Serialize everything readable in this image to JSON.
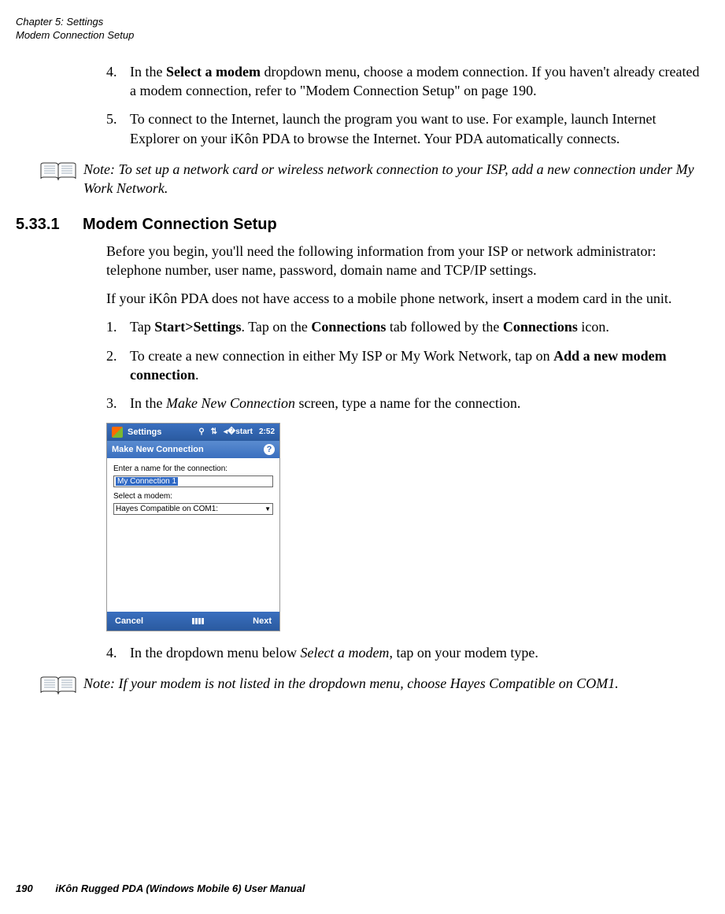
{
  "header": {
    "chapter": "Chapter 5:  Settings",
    "section": "Modem Connection Setup"
  },
  "step4": {
    "num": "4.",
    "pre": "In the ",
    "bold1": "Select a modem",
    "post": " dropdown menu, choose a modem connection. If you haven't already created a modem connection, refer to \"Modem Connection Setup\" on page 190."
  },
  "step5": {
    "num": "5.",
    "text": "To connect to the Internet, launch the program you want to use. For example, launch Internet Explorer on your iKôn PDA to browse the Internet. Your PDA automatically connects."
  },
  "note1": {
    "label": "Note:",
    "text": " To set up a network card or wireless network connection to your ISP, add a new connection under My Work Network."
  },
  "heading": {
    "num": "5.33.1",
    "title": "Modem Connection Setup"
  },
  "para1": "Before you begin, you'll need the following information from your ISP or network administrator: telephone number, user name, password, domain name and TCP/IP settings.",
  "para2": "If your iKôn PDA does not have access to a mobile phone network, insert a modem card in the unit.",
  "substeps": {
    "s1": {
      "num": "1.",
      "pre": "Tap ",
      "b1": "Start>Settings",
      "mid1": ". Tap on the ",
      "b2": "Connections",
      "mid2": " tab followed by the ",
      "b3": "Connections",
      "post": " icon."
    },
    "s2": {
      "num": "2.",
      "pre": "To create a new connection in either My ISP or My Work Network, tap on ",
      "b1": "Add a new modem connection",
      "post": "."
    },
    "s3": {
      "num": "3.",
      "pre": "In the ",
      "i1": "Make New Connection",
      "post": " screen, type a name for the connection."
    },
    "s4": {
      "num": "4.",
      "pre": "In the dropdown menu below ",
      "i1": "Select a modem",
      "post": ", tap on your modem type."
    }
  },
  "screenshot": {
    "titlebar_title": "Settings",
    "time": "2:52",
    "subtitle": "Make New Connection",
    "label1": "Enter a name for the connection:",
    "input_value": "My Connection 1",
    "label2": "Select a modem:",
    "dropdown_value": "Hayes Compatible on COM1:",
    "btn_cancel": "Cancel",
    "btn_next": "Next"
  },
  "note2": {
    "label": "Note:",
    "text": " If your modem is not listed in the dropdown menu, choose Hayes Compatible on COM1."
  },
  "footer": {
    "page": "190",
    "doc": "iKôn Rugged PDA (Windows Mobile 6) User Manual"
  }
}
